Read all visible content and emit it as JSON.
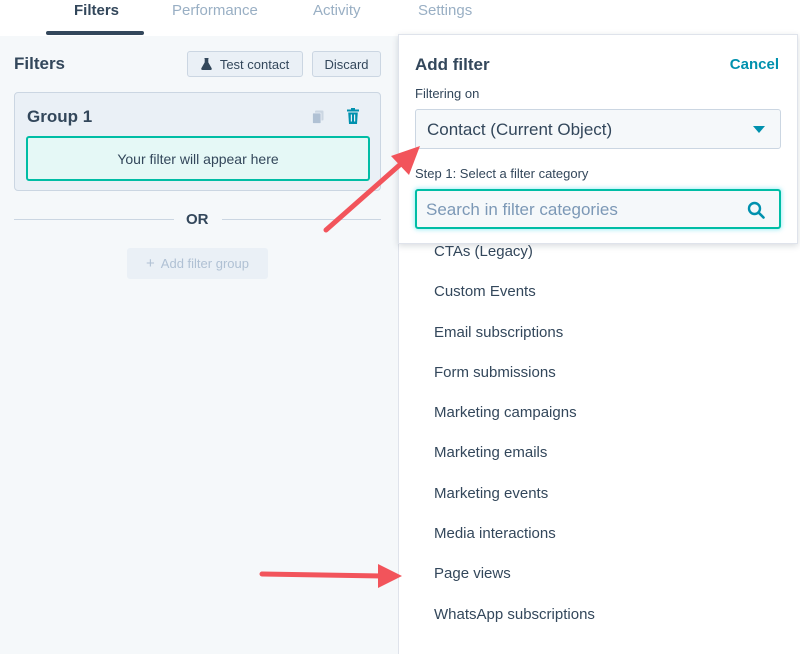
{
  "tabs": [
    {
      "label": "Filters",
      "active": true
    },
    {
      "label": "Performance",
      "active": false
    },
    {
      "label": "Activity",
      "active": false
    },
    {
      "label": "Settings",
      "active": false
    }
  ],
  "left_panel": {
    "title": "Filters",
    "test_contact_label": "Test contact",
    "discard_label": "Discard",
    "group": {
      "title": "Group 1",
      "placeholder": "Your filter will appear here"
    },
    "or_label": "OR",
    "add_filter_group_label": "Add filter group"
  },
  "add_filter": {
    "title": "Add filter",
    "cancel_label": "Cancel",
    "filtering_on_label": "Filtering on",
    "object_select_value": "Contact (Current Object)",
    "step_label": "Step 1: Select a filter category",
    "search_placeholder": "Search in filter categories",
    "search_value": "",
    "categories": [
      "CTAs (Legacy)",
      "Custom Events",
      "Email subscriptions",
      "Form submissions",
      "Marketing campaigns",
      "Marketing emails",
      "Marketing events",
      "Media interactions",
      "Page views",
      "WhatsApp subscriptions"
    ]
  },
  "icons": {
    "test_contact": "flask-icon",
    "copy": "copy-icon",
    "delete": "trash-icon",
    "add": "plus-icon",
    "dropdown": "caret-down-icon",
    "search": "search-icon"
  },
  "colors": {
    "text": "#33475b",
    "accent_teal": "#00bda5",
    "link": "#0091ae",
    "delete_icon": "#0091ae",
    "annotation_arrow": "#f2545b",
    "panel_bg": "#f5f8fa"
  }
}
